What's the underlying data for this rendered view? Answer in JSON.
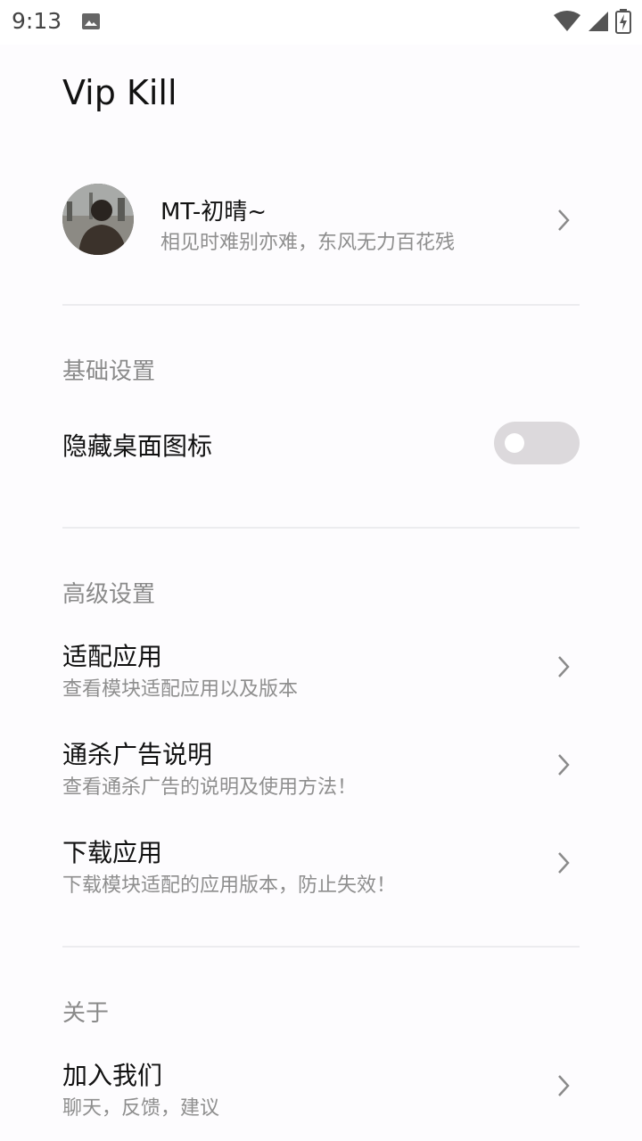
{
  "status_bar": {
    "time": "9:13",
    "icons": [
      "image-icon",
      "wifi-icon",
      "cell-signal-icon",
      "battery-charging-icon"
    ]
  },
  "app": {
    "title": "Vip Kill"
  },
  "profile": {
    "name": "MT-初晴~",
    "subtitle": "相见时难别亦难，东风无力百花残"
  },
  "sections": {
    "basic": {
      "title": "基础设置",
      "hide_icon": {
        "label": "隐藏桌面图标",
        "enabled": false
      }
    },
    "advanced": {
      "title": "高级设置",
      "items": [
        {
          "title": "适配应用",
          "subtitle": "查看模块适配应用以及版本"
        },
        {
          "title": "通杀广告说明",
          "subtitle": "查看通杀广告的说明及使用方法！"
        },
        {
          "title": "下载应用",
          "subtitle": "下载模块适配的应用版本，防止失效！"
        }
      ]
    },
    "about": {
      "title": "关于",
      "items": [
        {
          "title": "加入我们",
          "subtitle": "聊天，反馈，建议"
        }
      ]
    }
  },
  "colors": {
    "background": "#fdfcfe",
    "primary_text": "#111111",
    "secondary_text": "#8e8e8e",
    "switch_track_off": "#dcd9dc",
    "divider": "#ececef"
  }
}
